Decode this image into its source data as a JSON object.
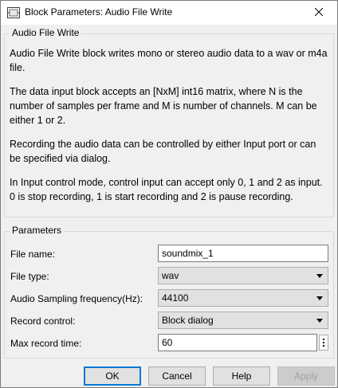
{
  "window": {
    "title": "Block Parameters: Audio File Write",
    "icon": "simulink-block-icon"
  },
  "description": {
    "group_title": "Audio File Write",
    "paragraphs": [
      "Audio File Write block writes mono or stereo audio data to a wav or m4a file.",
      "The data input block accepts an [NxM] int16 matrix, where N is the number of samples per frame and M is  number of channels. M can be either 1 or 2.",
      "Recording the audio data can be controlled by either Input port or can be specified via dialog.",
      "In Input control mode, control input can accept only 0, 1 and 2 as input. 0 is stop recording, 1 is start recording and 2 is pause recording."
    ]
  },
  "parameters": {
    "group_title": "Parameters",
    "file_name": {
      "label": "File name:",
      "value": "soundmix_1"
    },
    "file_type": {
      "label": "File type:",
      "value": "wav"
    },
    "sampling_frequency": {
      "label": "Audio Sampling frequency(Hz):",
      "value": "44100"
    },
    "record_control": {
      "label": "Record control:",
      "value": "Block dialog"
    },
    "max_record_time": {
      "label": "Max record time:",
      "value": "60"
    }
  },
  "buttons": {
    "ok": "OK",
    "cancel": "Cancel",
    "help": "Help",
    "apply": "Apply"
  },
  "colors": {
    "default_button_border": "#0078d7",
    "disabled_text": "#a0a0a0"
  }
}
